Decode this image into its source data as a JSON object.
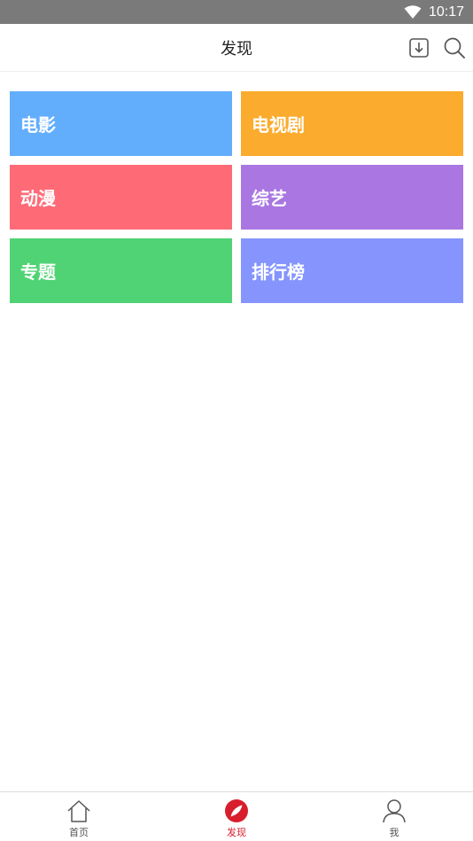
{
  "status_bar": {
    "time": "10:17",
    "icons": [
      "wifi-icon"
    ]
  },
  "app_bar": {
    "title": "发现",
    "actions": [
      {
        "icon": "download-icon"
      },
      {
        "icon": "search-icon"
      }
    ]
  },
  "categories": [
    {
      "label": "电影",
      "color": "#62aefd"
    },
    {
      "label": "电视剧",
      "color": "#fbab2d"
    },
    {
      "label": "动漫",
      "color": "#fe6b77"
    },
    {
      "label": "综艺",
      "color": "#a976e2"
    },
    {
      "label": "专题",
      "color": "#4fd374"
    },
    {
      "label": "排行榜",
      "color": "#8595fd"
    }
  ],
  "tab_bar": {
    "tabs": [
      {
        "label": "首页",
        "icon": "home-icon",
        "active": false
      },
      {
        "label": "发现",
        "icon": "compass-icon",
        "active": true
      },
      {
        "label": "我",
        "icon": "user-icon",
        "active": false
      }
    ],
    "active_color": "#d81e2c"
  }
}
